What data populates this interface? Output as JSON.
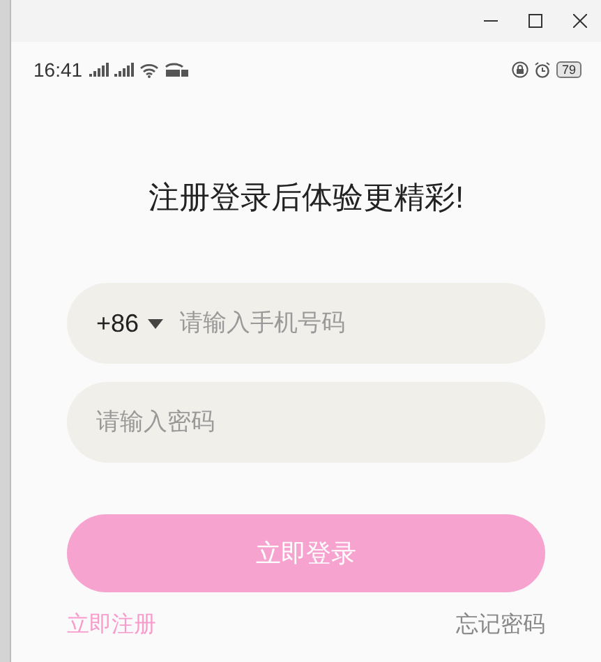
{
  "status_bar": {
    "time": "16:41",
    "battery": "79"
  },
  "title": "注册登录后体验更精彩!",
  "phone_field": {
    "country_code": "+86",
    "placeholder": "请输入手机号码"
  },
  "password_field": {
    "placeholder": "请输入密码"
  },
  "login_button": {
    "label": "立即登录",
    "disabled": true
  },
  "register_link": "立即注册",
  "forgot_link": "忘记密码"
}
